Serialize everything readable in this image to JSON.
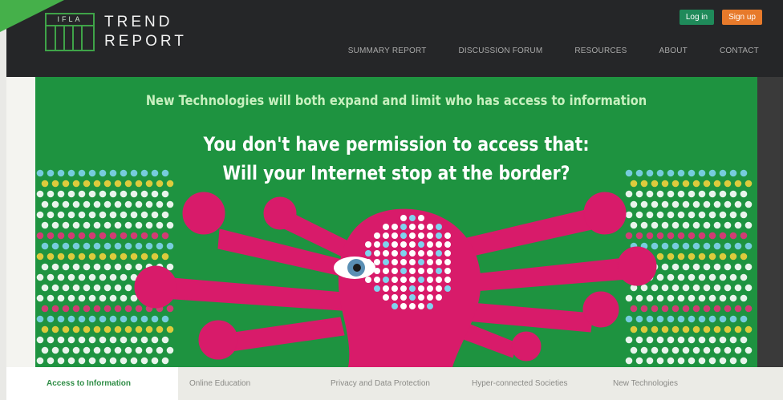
{
  "brand": {
    "logo_abbr": "IFLA",
    "logo_line1": "TREND",
    "logo_line2": "REPORT"
  },
  "auth": {
    "login_label": "Log in",
    "signup_label": "Sign up"
  },
  "nav": {
    "items": [
      {
        "label": "SUMMARY REPORT"
      },
      {
        "label": "DISCUSSION FORUM"
      },
      {
        "label": "RESOURCES"
      },
      {
        "label": "ABOUT"
      },
      {
        "label": "CONTACT"
      }
    ]
  },
  "hero": {
    "subtitle": "New Technologies will both expand and limit who has access to information",
    "headline_line1": "You don't have permission to access that:",
    "headline_line2": "Will your Internet stop at the border?"
  },
  "tabs": {
    "items": [
      {
        "label": "Access to Information",
        "active": true
      },
      {
        "label": "Online Education",
        "active": false
      },
      {
        "label": "Privacy and Data Protection",
        "active": false
      },
      {
        "label": "Hyper-connected Societies",
        "active": false
      },
      {
        "label": "New Technologies",
        "active": false
      }
    ]
  },
  "colors": {
    "accent_green": "#1e9340",
    "header_bg": "#252628",
    "figure_pink": "#d81b6a",
    "signup_orange": "#e77a2b",
    "login_green": "#1f8a5a"
  },
  "icons": {
    "hero_illustration": "multi-armed-figure-illustration"
  }
}
